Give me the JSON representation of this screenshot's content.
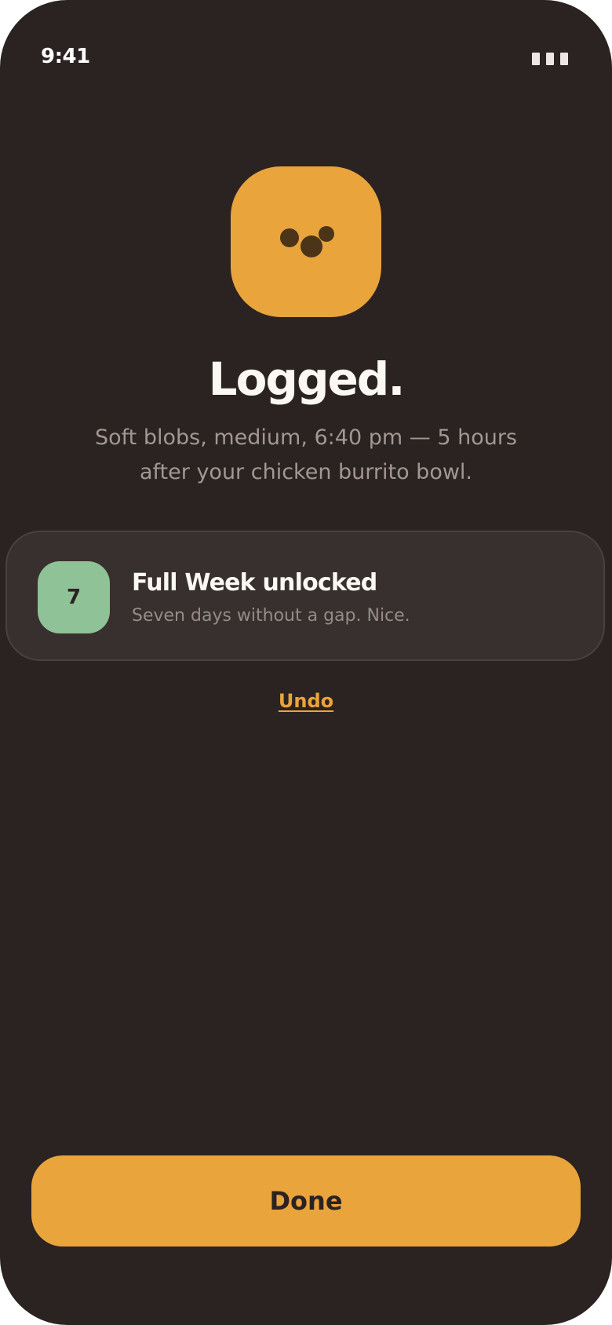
{
  "status_bar": {
    "time": "9:41",
    "battery_icon": "battery-icon"
  },
  "confirmation": {
    "icon": "stool-blobs-icon",
    "title": "Logged.",
    "subtitle": "Soft blobs, medium, 6:40 pm — 5 hours after your chicken burrito bowl."
  },
  "achievement": {
    "number": "7",
    "title": "Full Week unlocked",
    "description": "Seven days without a gap. Nice."
  },
  "undo_label": "Undo",
  "done_label": "Done",
  "colors": {
    "background": "#2b2321",
    "accent": "#e9a43c",
    "badge_green": "#8fc296",
    "card": "#38302e",
    "text_primary": "#fbf8f4",
    "text_secondary": "#a19893"
  }
}
